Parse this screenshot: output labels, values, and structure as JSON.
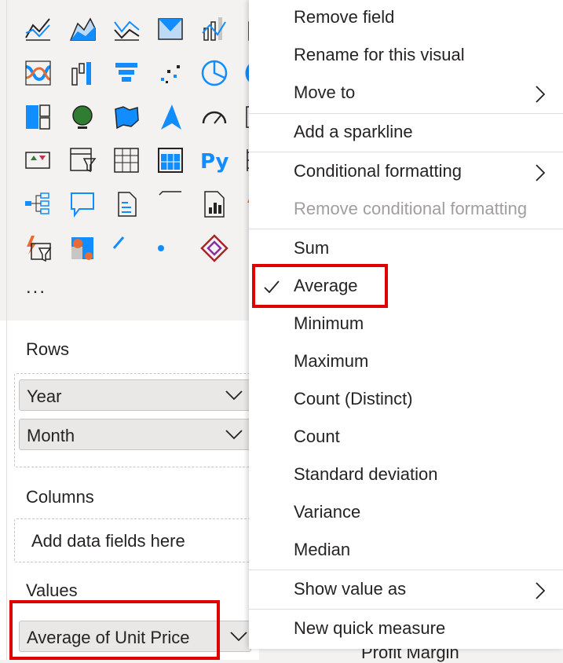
{
  "gallery": {
    "icons": [
      "line-chart-icon",
      "area-chart-icon",
      "stacked-area-chart-icon",
      "ribbon-area-chart-icon",
      "line-and-column-chart-icon",
      "line-and-stacked-column-chart-icon",
      "ribbon-chart-icon",
      "waterfall-chart-icon",
      "funnel-icon",
      "scatter-chart-icon",
      "pie-chart-icon",
      "donut-chart-icon",
      "treemap-icon",
      "map-icon",
      "filled-map-icon",
      "azure-map-icon",
      "gauge-icon",
      "card-icon",
      "multi-row-card-icon",
      "kpi-icon",
      "slicer-icon",
      "table-icon",
      "matrix-icon",
      "r-visual-icon",
      "python-visual-icon",
      "key-influencers-icon",
      "decomposition-tree-icon",
      "qa-icon",
      "smart-narrative-icon",
      "paginated-report-icon",
      "metrics-icon",
      "power-apps-icon",
      "power-automate-icon",
      "arcgis-map-icon",
      "power-apps-visual-icon",
      "more-visuals-icon"
    ],
    "more": "..."
  },
  "wells": {
    "rows_label": "Rows",
    "rows_fields": [
      "Year",
      "Month"
    ],
    "columns_label": "Columns",
    "columns_placeholder": "Add data fields here",
    "values_label": "Values",
    "values_field": "Average of Unit Price"
  },
  "menu": {
    "items": [
      {
        "label": "Remove field",
        "submenu": false,
        "checked": false,
        "disabled": false
      },
      {
        "label": "Rename for this visual",
        "submenu": false,
        "checked": false,
        "disabled": false
      },
      {
        "label": "Move to",
        "submenu": true,
        "checked": false,
        "disabled": false
      },
      {
        "label": "Add a sparkline",
        "submenu": false,
        "checked": false,
        "disabled": false
      },
      {
        "label": "Conditional formatting",
        "submenu": true,
        "checked": false,
        "disabled": false
      },
      {
        "label": "Remove conditional formatting",
        "submenu": false,
        "checked": false,
        "disabled": true
      },
      {
        "label": "Sum",
        "submenu": false,
        "checked": false,
        "disabled": false
      },
      {
        "label": "Average",
        "submenu": false,
        "checked": true,
        "disabled": false
      },
      {
        "label": "Minimum",
        "submenu": false,
        "checked": false,
        "disabled": false
      },
      {
        "label": "Maximum",
        "submenu": false,
        "checked": false,
        "disabled": false
      },
      {
        "label": "Count (Distinct)",
        "submenu": false,
        "checked": false,
        "disabled": false
      },
      {
        "label": "Count",
        "submenu": false,
        "checked": false,
        "disabled": false
      },
      {
        "label": "Standard deviation",
        "submenu": false,
        "checked": false,
        "disabled": false
      },
      {
        "label": "Variance",
        "submenu": false,
        "checked": false,
        "disabled": false
      },
      {
        "label": "Median",
        "submenu": false,
        "checked": false,
        "disabled": false
      },
      {
        "label": "Show value as",
        "submenu": true,
        "checked": false,
        "disabled": false
      },
      {
        "label": "New quick measure",
        "submenu": false,
        "checked": false,
        "disabled": false
      }
    ]
  },
  "background": {
    "field_list_item": "Profit Margin"
  },
  "colors": {
    "accent": "#118dff",
    "highlight_red": "#e00000",
    "icon_blue": "#118dff",
    "icon_dark": "#252423",
    "icon_orange": "#e66c37"
  }
}
